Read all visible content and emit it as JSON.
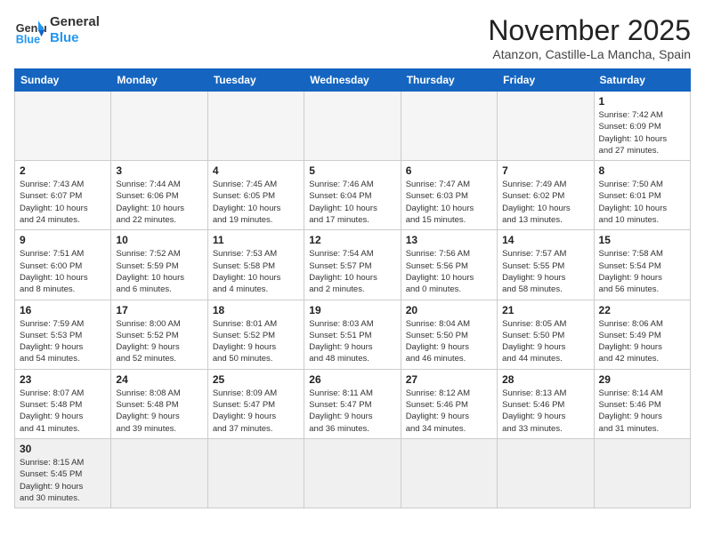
{
  "header": {
    "logo_general": "General",
    "logo_blue": "Blue",
    "month": "November 2025",
    "location": "Atanzon, Castille-La Mancha, Spain"
  },
  "weekdays": [
    "Sunday",
    "Monday",
    "Tuesday",
    "Wednesday",
    "Thursday",
    "Friday",
    "Saturday"
  ],
  "weeks": [
    [
      {
        "day": "",
        "info": ""
      },
      {
        "day": "",
        "info": ""
      },
      {
        "day": "",
        "info": ""
      },
      {
        "day": "",
        "info": ""
      },
      {
        "day": "",
        "info": ""
      },
      {
        "day": "",
        "info": ""
      },
      {
        "day": "1",
        "info": "Sunrise: 7:42 AM\nSunset: 6:09 PM\nDaylight: 10 hours\nand 27 minutes."
      }
    ],
    [
      {
        "day": "2",
        "info": "Sunrise: 7:43 AM\nSunset: 6:07 PM\nDaylight: 10 hours\nand 24 minutes."
      },
      {
        "day": "3",
        "info": "Sunrise: 7:44 AM\nSunset: 6:06 PM\nDaylight: 10 hours\nand 22 minutes."
      },
      {
        "day": "4",
        "info": "Sunrise: 7:45 AM\nSunset: 6:05 PM\nDaylight: 10 hours\nand 19 minutes."
      },
      {
        "day": "5",
        "info": "Sunrise: 7:46 AM\nSunset: 6:04 PM\nDaylight: 10 hours\nand 17 minutes."
      },
      {
        "day": "6",
        "info": "Sunrise: 7:47 AM\nSunset: 6:03 PM\nDaylight: 10 hours\nand 15 minutes."
      },
      {
        "day": "7",
        "info": "Sunrise: 7:49 AM\nSunset: 6:02 PM\nDaylight: 10 hours\nand 13 minutes."
      },
      {
        "day": "8",
        "info": "Sunrise: 7:50 AM\nSunset: 6:01 PM\nDaylight: 10 hours\nand 10 minutes."
      }
    ],
    [
      {
        "day": "9",
        "info": "Sunrise: 7:51 AM\nSunset: 6:00 PM\nDaylight: 10 hours\nand 8 minutes."
      },
      {
        "day": "10",
        "info": "Sunrise: 7:52 AM\nSunset: 5:59 PM\nDaylight: 10 hours\nand 6 minutes."
      },
      {
        "day": "11",
        "info": "Sunrise: 7:53 AM\nSunset: 5:58 PM\nDaylight: 10 hours\nand 4 minutes."
      },
      {
        "day": "12",
        "info": "Sunrise: 7:54 AM\nSunset: 5:57 PM\nDaylight: 10 hours\nand 2 minutes."
      },
      {
        "day": "13",
        "info": "Sunrise: 7:56 AM\nSunset: 5:56 PM\nDaylight: 10 hours\nand 0 minutes."
      },
      {
        "day": "14",
        "info": "Sunrise: 7:57 AM\nSunset: 5:55 PM\nDaylight: 9 hours\nand 58 minutes."
      },
      {
        "day": "15",
        "info": "Sunrise: 7:58 AM\nSunset: 5:54 PM\nDaylight: 9 hours\nand 56 minutes."
      }
    ],
    [
      {
        "day": "16",
        "info": "Sunrise: 7:59 AM\nSunset: 5:53 PM\nDaylight: 9 hours\nand 54 minutes."
      },
      {
        "day": "17",
        "info": "Sunrise: 8:00 AM\nSunset: 5:52 PM\nDaylight: 9 hours\nand 52 minutes."
      },
      {
        "day": "18",
        "info": "Sunrise: 8:01 AM\nSunset: 5:52 PM\nDaylight: 9 hours\nand 50 minutes."
      },
      {
        "day": "19",
        "info": "Sunrise: 8:03 AM\nSunset: 5:51 PM\nDaylight: 9 hours\nand 48 minutes."
      },
      {
        "day": "20",
        "info": "Sunrise: 8:04 AM\nSunset: 5:50 PM\nDaylight: 9 hours\nand 46 minutes."
      },
      {
        "day": "21",
        "info": "Sunrise: 8:05 AM\nSunset: 5:50 PM\nDaylight: 9 hours\nand 44 minutes."
      },
      {
        "day": "22",
        "info": "Sunrise: 8:06 AM\nSunset: 5:49 PM\nDaylight: 9 hours\nand 42 minutes."
      }
    ],
    [
      {
        "day": "23",
        "info": "Sunrise: 8:07 AM\nSunset: 5:48 PM\nDaylight: 9 hours\nand 41 minutes."
      },
      {
        "day": "24",
        "info": "Sunrise: 8:08 AM\nSunset: 5:48 PM\nDaylight: 9 hours\nand 39 minutes."
      },
      {
        "day": "25",
        "info": "Sunrise: 8:09 AM\nSunset: 5:47 PM\nDaylight: 9 hours\nand 37 minutes."
      },
      {
        "day": "26",
        "info": "Sunrise: 8:11 AM\nSunset: 5:47 PM\nDaylight: 9 hours\nand 36 minutes."
      },
      {
        "day": "27",
        "info": "Sunrise: 8:12 AM\nSunset: 5:46 PM\nDaylight: 9 hours\nand 34 minutes."
      },
      {
        "day": "28",
        "info": "Sunrise: 8:13 AM\nSunset: 5:46 PM\nDaylight: 9 hours\nand 33 minutes."
      },
      {
        "day": "29",
        "info": "Sunrise: 8:14 AM\nSunset: 5:46 PM\nDaylight: 9 hours\nand 31 minutes."
      }
    ],
    [
      {
        "day": "30",
        "info": "Sunrise: 8:15 AM\nSunset: 5:45 PM\nDaylight: 9 hours\nand 30 minutes."
      },
      {
        "day": "",
        "info": ""
      },
      {
        "day": "",
        "info": ""
      },
      {
        "day": "",
        "info": ""
      },
      {
        "day": "",
        "info": ""
      },
      {
        "day": "",
        "info": ""
      },
      {
        "day": "",
        "info": ""
      }
    ]
  ]
}
